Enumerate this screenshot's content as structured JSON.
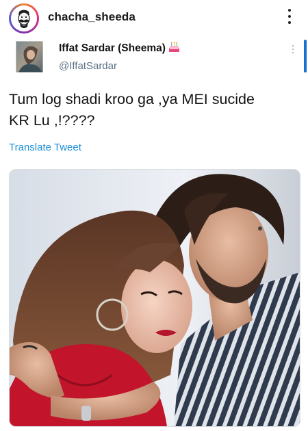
{
  "post": {
    "username": "chacha_sheeda"
  },
  "tweet": {
    "display_name": "Iffat Sardar (Sheema)",
    "handle": "@IffatSardar",
    "text": "Tum log shadi kroo ga ,ya MEI sucide\nKR Lu ,!????",
    "translate_label": "Translate Tweet",
    "name_emoji_icon": "birthday-cake-icon",
    "media_description_icon": "photo"
  },
  "colors": {
    "link": "#1d8fd8",
    "handle": "#5b7083",
    "scroll_indicator": "#1a6fd1"
  }
}
